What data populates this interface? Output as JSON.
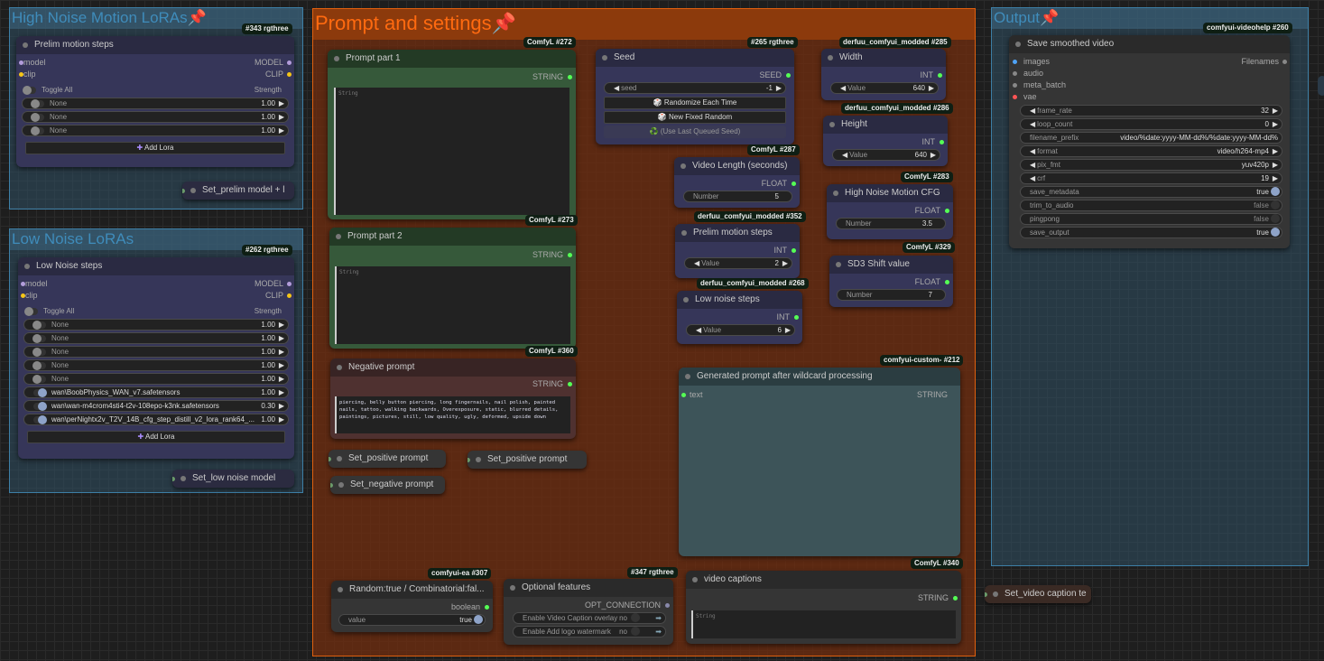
{
  "groups": {
    "high": "High Noise Motion LoRAs📌",
    "low": "Low Noise LoRAs",
    "prompt": "Prompt and settings📌",
    "output": "Output📌"
  },
  "prelim_lora": {
    "badge": "#343 rgthree",
    "title": "Prelim motion steps",
    "in": [
      "model",
      "clip"
    ],
    "out": [
      "MODEL",
      "CLIP"
    ],
    "toggle_all": "Toggle All",
    "strength": "Strength",
    "loras": [
      {
        "name": "None",
        "value": "1.00"
      },
      {
        "name": "None",
        "value": "1.00"
      },
      {
        "name": "None",
        "value": "1.00"
      }
    ],
    "add": "Add Lora"
  },
  "set_prelim": "Set_prelim model + l",
  "low_lora": {
    "badge": "#262 rgthree",
    "title": "Low Noise steps",
    "in": [
      "model",
      "clip"
    ],
    "out": [
      "MODEL",
      "CLIP"
    ],
    "toggle_all": "Toggle All",
    "strength": "Strength",
    "loras": [
      {
        "name": "None",
        "value": "1.00"
      },
      {
        "name": "None",
        "value": "1.00"
      },
      {
        "name": "None",
        "value": "1.00"
      },
      {
        "name": "None",
        "value": "1.00"
      },
      {
        "name": "None",
        "value": "1.00"
      },
      {
        "name": "wan\\BoobPhysics_WAN_v7.safetensors",
        "value": "1.00"
      },
      {
        "name": "wan\\wan-m4crom4sti4-t2v-108epo-k3nk.safetensors",
        "value": "0.30"
      },
      {
        "name": "wan\\perNightx2v_T2V_14B_cfg_step_distill_v2_lora_rank64_...",
        "value": "1.00"
      }
    ],
    "add": "Add Lora"
  },
  "set_low": "Set_low noise model",
  "prompt1": {
    "badge_a": "ComfyL",
    "badge_b": "#272",
    "title": "Prompt part 1",
    "out": "STRING",
    "placeholder": "String"
  },
  "prompt2": {
    "badge_a": "ComfyL",
    "badge_b": "#273",
    "title": "Prompt part 2",
    "out": "STRING",
    "placeholder": "String"
  },
  "negative": {
    "badge_a": "ComfyL",
    "badge_b": "#360",
    "title": "Negative prompt",
    "out": "STRING",
    "text": "piercing, belly button piercing, long fingernails, nail polish, painted nails, tattoo, walking backwards, Overexposure, static, blurred details, paintings, pictures, still, low quality, ugly, deformed, upside down"
  },
  "set_pos1": "Set_positive prompt",
  "set_pos2": "Set_positive prompt",
  "set_neg": "Set_negative prompt",
  "seed": {
    "badge": "#265 rgthree",
    "title": "Seed",
    "out": "SEED",
    "label": "seed",
    "value": "-1",
    "btn_random": "🎲 Randomize Each Time",
    "btn_fixed": "🎲 New Fixed Random",
    "btn_last": "♻️ (Use Last Queued Seed)"
  },
  "width": {
    "badge_a": "derfuu_comfyui_modded",
    "badge_b": "#285",
    "title": "Width",
    "out": "INT",
    "label": "Value",
    "value": "640"
  },
  "height": {
    "badge_a": "derfuu_comfyui_modded",
    "badge_b": "#286",
    "title": "Height",
    "out": "INT",
    "label": "Value",
    "value": "640"
  },
  "video_length": {
    "badge_a": "ComfyL",
    "badge_b": "#287",
    "title": "Video Length (seconds)",
    "out": "FLOAT",
    "label": "Number",
    "value": "5"
  },
  "cfg": {
    "badge_a": "ComfyL",
    "badge_b": "#283",
    "title": "High Noise Motion CFG",
    "out": "FLOAT",
    "label": "Number",
    "value": "3.5"
  },
  "prelim_steps": {
    "badge_a": "derfuu_comfyui_modded",
    "badge_b": "#352",
    "title": "Prelim motion steps",
    "out": "INT",
    "label": "Value",
    "value": "2"
  },
  "sd3": {
    "badge_a": "ComfyL",
    "badge_b": "#329",
    "title": "SD3 Shift value",
    "out": "FLOAT",
    "label": "Number",
    "value": "7"
  },
  "low_steps": {
    "badge_a": "derfuu_comfyui_modded",
    "badge_b": "#268",
    "title": "Low noise steps",
    "out": "INT",
    "label": "Value",
    "value": "6"
  },
  "generated": {
    "badge_a": "comfyui-custom-",
    "badge_b": "#212",
    "title": "Generated prompt after wildcard processing",
    "in": "text",
    "out": "STRING"
  },
  "random": {
    "badge_a": "comfyui-ea",
    "badge_b": "#307",
    "title": "Random:true / Combinatorial:fal...",
    "out": "boolean",
    "label": "value",
    "value": "true"
  },
  "optional": {
    "badge": "#347 rgthree",
    "title": "Optional features",
    "out": "OPT_CONNECTION",
    "rows": [
      {
        "label": "Enable Video Caption overlay",
        "value": "no"
      },
      {
        "label": "Enable Add logo watermark",
        "value": "no"
      }
    ]
  },
  "captions": {
    "badge_a": "ComfyL",
    "badge_b": "#340",
    "title": "video captions",
    "out": "STRING",
    "placeholder": "String"
  },
  "set_caption": "Set_video caption te",
  "save": {
    "badge_a": "comfyui-videohelp",
    "badge_b": "#260",
    "title": "Save smoothed video",
    "in": [
      "images",
      "audio",
      "meta_batch",
      "vae"
    ],
    "out": "Filenames",
    "widgets": [
      {
        "label": "frame_rate",
        "value": "32"
      },
      {
        "label": "loop_count",
        "value": "0"
      },
      {
        "label": "filename_prefix",
        "value": "video/%date:yyyy-MM-dd%/%date:yyyy-MM-dd%"
      },
      {
        "label": "format",
        "value": "video/h264-mp4"
      },
      {
        "label": "pix_fmt",
        "value": "yuv420p"
      },
      {
        "label": "crf",
        "value": "19"
      }
    ],
    "toggles": [
      {
        "label": "save_metadata",
        "value": "true"
      },
      {
        "label": "trim_to_audio",
        "value": "false"
      },
      {
        "label": "pingpong",
        "value": "false"
      },
      {
        "label": "save_output",
        "value": "true"
      }
    ]
  }
}
